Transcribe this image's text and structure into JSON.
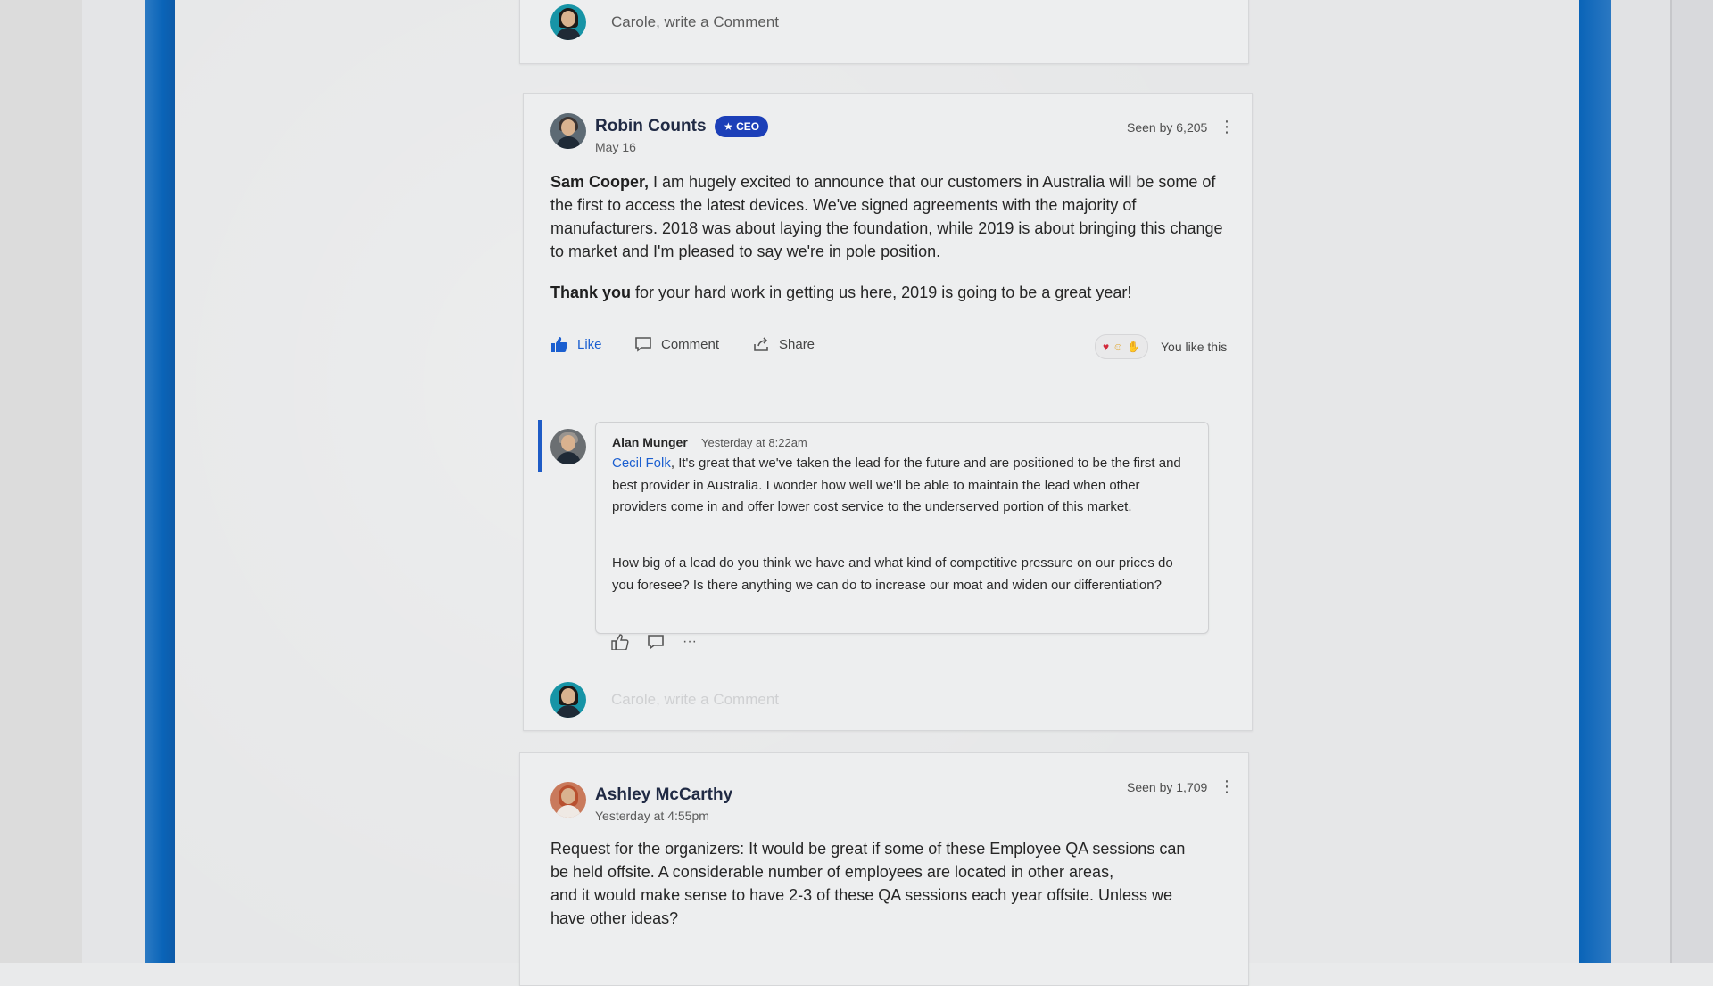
{
  "top_composer": {
    "placeholder": "Carole, write a Comment"
  },
  "post1": {
    "author": "Robin Counts",
    "badge": "★ CEO",
    "date": "May 16",
    "seen": "Seen by 6,205",
    "mention": "Sam Cooper,",
    "paragraph1": " I am hugely excited to announce that our customers in Australia will be some of the first to access the latest devices. We've signed agreements with the majority of manufacturers. 2018 was about laying the foundation, while 2019 is about bringing this change to market and I'm pleased to say we're in pole position.",
    "thanks": "Thank you",
    "paragraph2": " for your hard work in getting us here, 2019 is going to be a great year!",
    "actions": {
      "like": "Like",
      "comment": "Comment",
      "share": "Share"
    },
    "reactions_text": "You like this",
    "reply": {
      "author": "Alan Munger",
      "time": "Yesterday at 8:22am",
      "mention": "Cecil Folk",
      "text1": ", It's great that we've taken the lead for the future and are positioned to be the first and best provider in Australia. I wonder how well we'll be able to maintain the lead when other providers come in and offer lower cost service to the underserved portion of this market.",
      "text2": "How big of a lead do you think we have and what kind of competitive pressure on our prices do you foresee? Is there anything we can do to increase our moat and widen our differentiation?"
    },
    "composer_placeholder": "Carole, write a Comment"
  },
  "post2": {
    "author": "Ashley McCarthy",
    "date": "Yesterday at 4:55pm",
    "seen": "Seen by 1,709",
    "line1": "Request for the organizers: It would be great if some of these Employee QA sessions can",
    "line2": "be held offsite. A considerable number of employees are located in other areas,",
    "line3": "and it would make sense to have 2-3 of these QA sessions each year offsite. Unless we",
    "line4": "have other ideas?"
  },
  "colors": {
    "accent": "#1b5fd0",
    "badge": "#1c3fb8",
    "frame_blue": "#0a64b8"
  },
  "icons": [
    "like-icon",
    "comment-icon",
    "share-icon",
    "more-icon",
    "heart-icon",
    "smile-icon",
    "clap-icon"
  ]
}
